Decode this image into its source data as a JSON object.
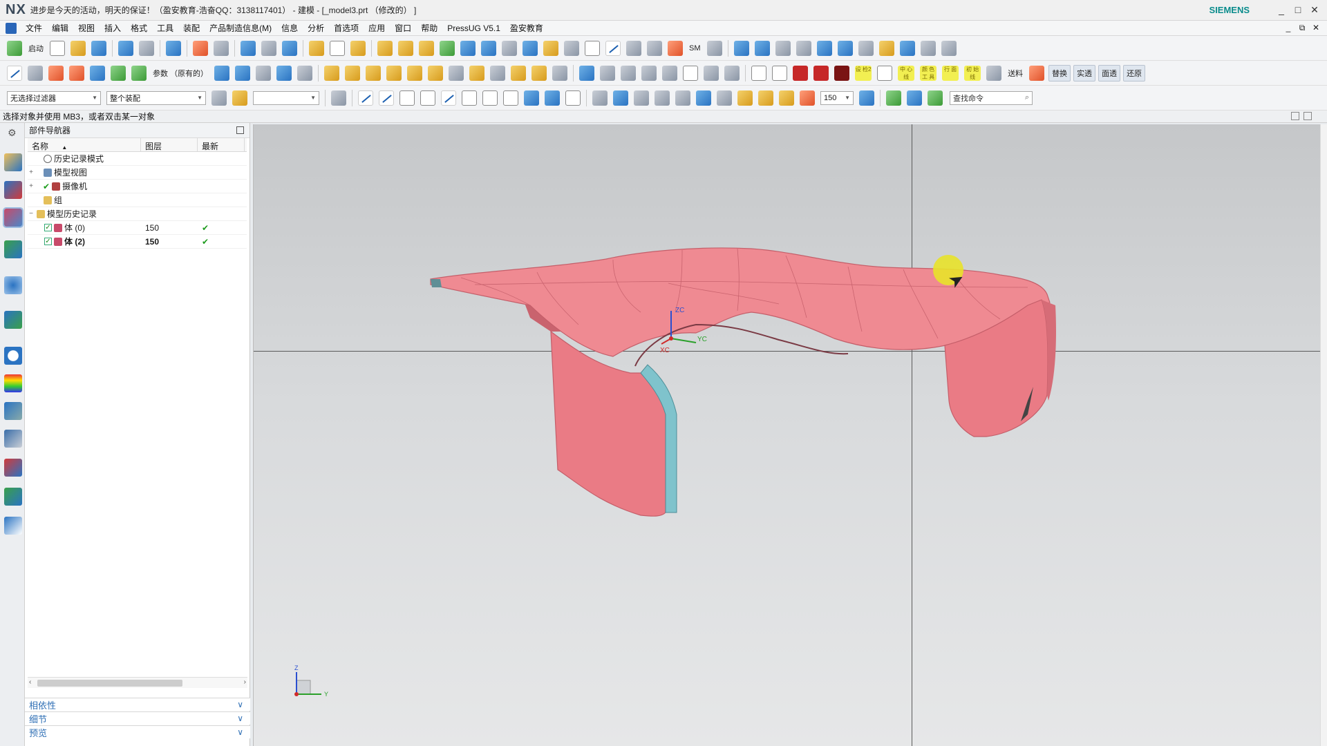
{
  "titlebar": {
    "logo": "NX",
    "title": "进步是今天的活动，明天的保证！（盈安教育-浩奋QQ：3138117401） - 建模 - [_model3.prt （修改的） ]",
    "brand": "SIEMENS",
    "minimize": "_",
    "maximize": "□",
    "close": "✕"
  },
  "menubar": {
    "items": [
      "文件",
      "编辑",
      "视图",
      "插入",
      "格式",
      "工具",
      "装配",
      "产品制造信息(M)",
      "信息",
      "分析",
      "首选项",
      "应用",
      "窗口",
      "帮助",
      "PressUG V5.1",
      "盈安教育"
    ],
    "restore": "⧉",
    "close": "✕",
    "min": "_"
  },
  "toolbar1": {
    "start_label": "启动",
    "sm_label": "SM"
  },
  "toolbar2": {
    "params_label": "参数 （原有的）",
    "send_label": "送料",
    "replace_label": "替换",
    "solid_label": "实透",
    "surface_label": "面透",
    "restore_label": "还原",
    "yellow_buttons": [
      "设 检2",
      "中 心 线",
      "颜 色 工 具",
      "行 面",
      "初 始 线"
    ]
  },
  "toolbar3": {
    "filter_value": "无选择过滤器",
    "assembly_value": "整个装配",
    "empty_combo": "",
    "layer_value": "150",
    "search_placeholder": "查找命令"
  },
  "cue": {
    "text": "选择对象并使用 MB3，或者双击某一对象"
  },
  "navigator": {
    "title": "部件导航器",
    "columns": [
      "名称",
      "图层",
      "最新"
    ],
    "sort_indicator": "▲",
    "rows": [
      {
        "expand": "",
        "label": "历史记录模式",
        "layer": "",
        "latest": ""
      },
      {
        "expand": "+",
        "label": "模型视图",
        "layer": "",
        "latest": ""
      },
      {
        "expand": "+",
        "label": "摄像机",
        "layer": "",
        "latest": ""
      },
      {
        "expand": "",
        "label": "组",
        "layer": "",
        "latest": ""
      },
      {
        "expand": "−",
        "label": "模型历史记录",
        "layer": "",
        "latest": ""
      },
      {
        "expand": "",
        "label": "体 (0)",
        "layer": "150",
        "latest": "✔"
      },
      {
        "expand": "",
        "label": "体 (2)",
        "layer": "150",
        "latest": "✔"
      }
    ],
    "panels": [
      "相依性",
      "细节",
      "预览"
    ]
  },
  "viewport": {
    "csys_labels": {
      "zc": "ZC",
      "yc": "YC",
      "xc": "XC"
    },
    "triad_labels": {
      "z": "Z",
      "y": "Y"
    },
    "part_color": "#ec8189",
    "part_edge": "#d06a74",
    "cyan_face": "#7fc3cc"
  }
}
